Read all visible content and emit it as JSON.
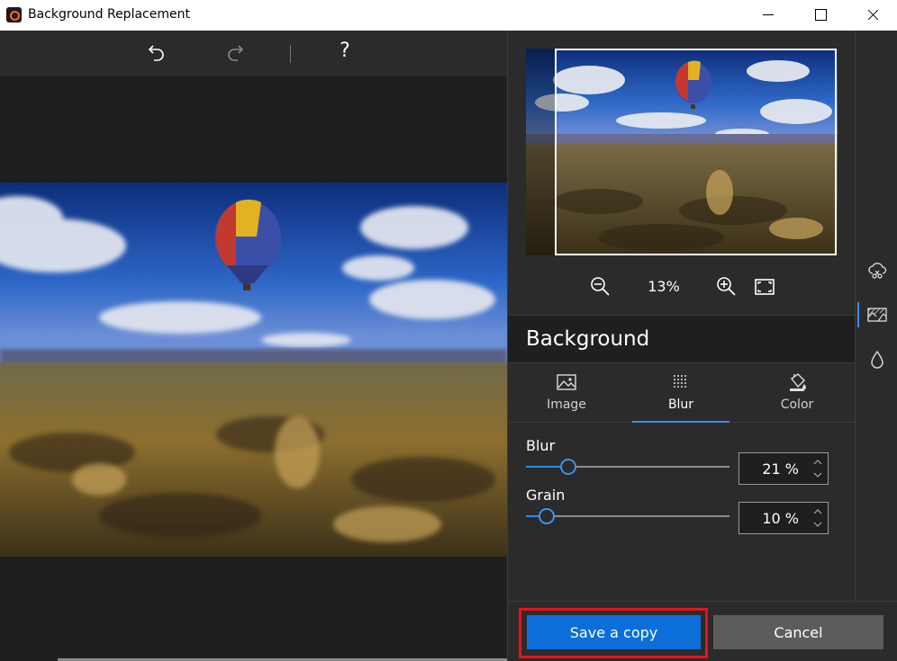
{
  "window": {
    "title": "Background Replacement",
    "controls": [
      "minimize",
      "maximize",
      "close"
    ]
  },
  "toolbar": {
    "undo_icon": "undo-icon",
    "redo_icon": "redo-icon",
    "help_label": "?"
  },
  "preview": {
    "zoom_label": "13%"
  },
  "panel": {
    "section_title": "Background",
    "tabs": [
      {
        "label": "Image",
        "icon": "image-icon",
        "active": false
      },
      {
        "label": "Blur",
        "icon": "blur-grid-icon",
        "active": true
      },
      {
        "label": "Color",
        "icon": "paint-bucket-icon",
        "active": false
      }
    ],
    "sliders": [
      {
        "label": "Blur",
        "value_text": "21 %",
        "value": 21
      },
      {
        "label": "Grain",
        "value_text": "10 %",
        "value": 10
      }
    ]
  },
  "rail": {
    "items": [
      {
        "icon": "cloud-scissors-icon",
        "active": false
      },
      {
        "icon": "background-replace-icon",
        "active": true
      },
      {
        "icon": "droplet-icon",
        "active": false
      }
    ]
  },
  "footer": {
    "save_label": "Save a copy",
    "cancel_label": "Cancel"
  },
  "colors": {
    "accent": "#0c6ed8",
    "highlight": "#e8121c",
    "panel_bg": "#2b2b2b"
  }
}
